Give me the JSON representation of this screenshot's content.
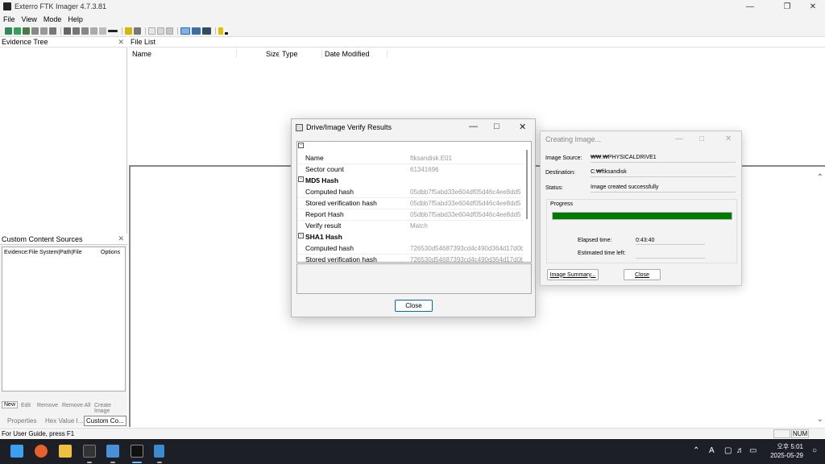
{
  "window": {
    "title": "Exterro FTK Imager 4.7.3.81"
  },
  "menu": [
    "File",
    "View",
    "Mode",
    "Help"
  ],
  "panels": {
    "evidence_tree": "Evidence Tree",
    "file_list": "File List",
    "custom_sources": "Custom Content Sources"
  },
  "file_columns": [
    "Name",
    "Size",
    "Type",
    "Date Modified"
  ],
  "custom": {
    "col1": "Evidence:File System|Path|File",
    "col2": "Options",
    "buttons": [
      "New",
      "Edit",
      "Remove",
      "Remove All",
      "Create Image"
    ]
  },
  "tabs": [
    "Properties",
    "Hex Value I...",
    "Custom Co..."
  ],
  "status": {
    "text": "For User Guide, press F1",
    "num": "NUM"
  },
  "verify_dialog": {
    "title": "Drive/Image Verify Results",
    "rows": [
      {
        "key": "Name",
        "value": "ftksandisk.E01"
      },
      {
        "key": "Sector count",
        "value": "61341696"
      }
    ],
    "md5_header": "MD5 Hash",
    "md5_rows": [
      {
        "key": "Computed hash",
        "value": "05dbb7f5abd33e604df05d46c4ee8dd5"
      },
      {
        "key": "Stored verification hash",
        "value": "05dbb7f5abd33e604df05d46c4ee8dd5"
      },
      {
        "key": "Report Hash",
        "value": "05dbb7f5abd33e604df05d46c4ee8dd5"
      },
      {
        "key": "Verify result",
        "value": "Match"
      }
    ],
    "sha1_header": "SHA1 Hash",
    "sha1_rows": [
      {
        "key": "Computed hash",
        "value": "726530d54687393cd4c490d364d17d0b"
      },
      {
        "key": "Stored verification hash",
        "value": "726530d54687393cd4c490d364d17d0b"
      }
    ],
    "close": "Close"
  },
  "create_dialog": {
    "title": "Creating Image...",
    "image_source_label": "Image Source:",
    "image_source": "₩₩.₩PHYSICALDRIVE1",
    "destination_label": "Destination:",
    "destination": "C:₩ftksandisk",
    "status_label": "Status:",
    "status": "Image created successfully",
    "progress_label": "Progress",
    "progress": 1.0,
    "elapsed_label": "Elapsed time:",
    "elapsed": "0:43:40",
    "estimated_label": "Estimated time left:",
    "estimated": "",
    "summary_button": "Image Summary...",
    "close_button": "Close"
  },
  "clock": {
    "time": "오후 5:01",
    "date": "2025-05-29"
  },
  "tray": {
    "lang": "A"
  }
}
